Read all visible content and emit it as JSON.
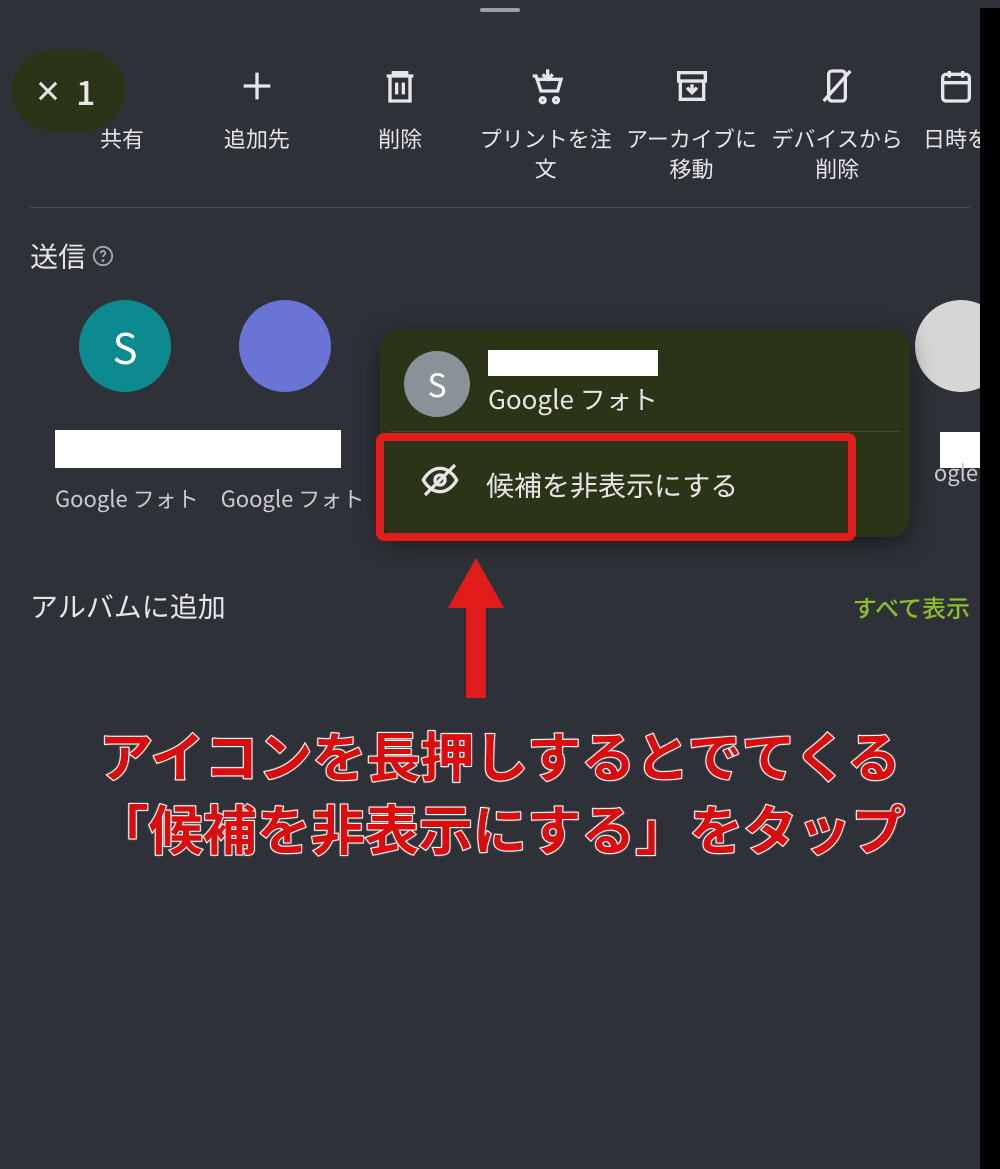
{
  "header": {
    "selection_count": "1",
    "actions": {
      "share": "共有",
      "add_to": "追加先",
      "delete": "削除",
      "order_print": "プリントを注文",
      "archive": "アーカイブに移動",
      "delete_from_device": "デバイスから削除",
      "edit_datetime": "日時を"
    }
  },
  "send": {
    "title": "送信",
    "contacts": [
      {
        "initial": "S",
        "app": "Google フォト"
      },
      {
        "initial": "",
        "app": "Google フォト"
      },
      {
        "initial": "",
        "app": "ogle フ"
      }
    ]
  },
  "popup": {
    "initial": "S",
    "app": "Google フォト",
    "hide_suggestion": "候補を非表示にする"
  },
  "album": {
    "title": "アルバムに追加",
    "show_all": "すべて表示"
  },
  "annotation": {
    "line1": "アイコンを長押しするとでてくる",
    "line2": "「候補を非表示にする」をタップ"
  }
}
